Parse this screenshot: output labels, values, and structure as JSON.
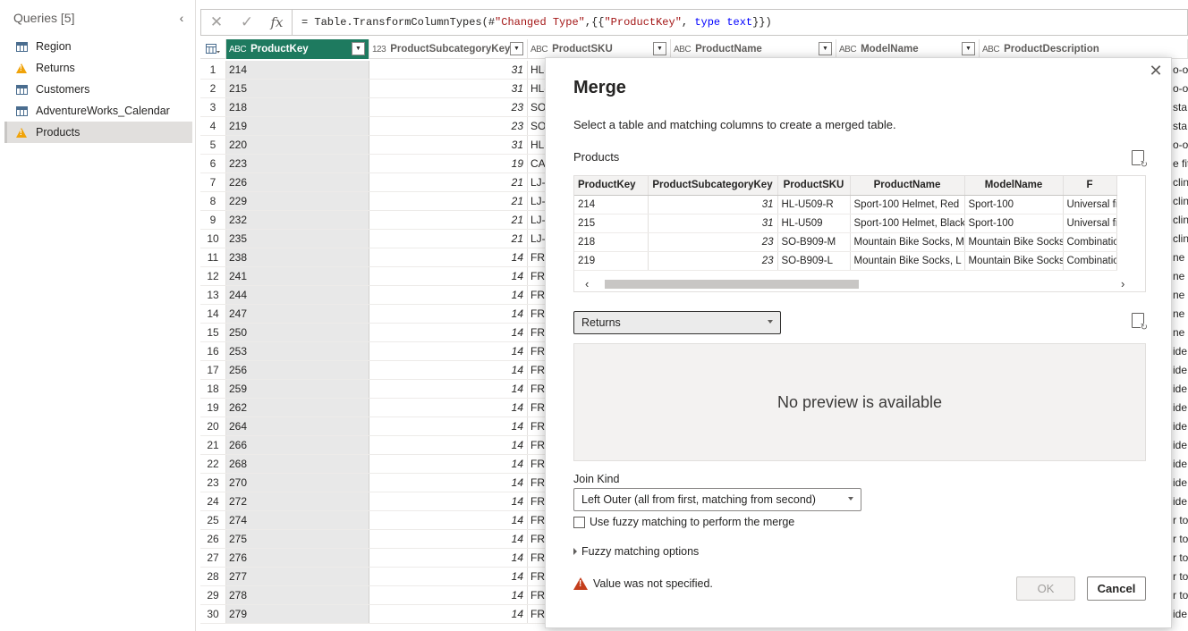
{
  "queries": {
    "header": "Queries [5]",
    "items": [
      {
        "label": "Region",
        "icon": "table-icon",
        "warning": false
      },
      {
        "label": "Returns",
        "icon": "warning-icon",
        "warning": true
      },
      {
        "label": "Customers",
        "icon": "table-icon",
        "warning": false
      },
      {
        "label": "AdventureWorks_Calendar",
        "icon": "table-icon",
        "warning": false
      },
      {
        "label": "Products",
        "icon": "warning-icon",
        "warning": true,
        "selected": true
      }
    ]
  },
  "formula": {
    "prefix": "= Table.TransformColumnTypes(#",
    "str1": "\"Changed Type\"",
    "mid": ",{{",
    "str2": "\"ProductKey\"",
    "mid2": ", ",
    "kw": "type text",
    "suffix": "}})"
  },
  "grid": {
    "columns": [
      {
        "type": "ABC",
        "name": "ProductKey"
      },
      {
        "type": "123",
        "name": "ProductSubcategoryKey"
      },
      {
        "type": "ABC",
        "name": "ProductSKU"
      },
      {
        "type": "ABC",
        "name": "ProductName"
      },
      {
        "type": "ABC",
        "name": "ModelName"
      },
      {
        "type": "ABC",
        "name": "ProductDescription"
      }
    ],
    "rows": [
      {
        "n": "1",
        "key": "214",
        "sub": "31",
        "sku": "HL-",
        "right": "o-or"
      },
      {
        "n": "2",
        "key": "215",
        "sub": "31",
        "sku": "HL-",
        "right": "o-or"
      },
      {
        "n": "3",
        "key": "218",
        "sub": "23",
        "sku": "SO",
        "right": "sta"
      },
      {
        "n": "4",
        "key": "219",
        "sub": "23",
        "sku": "SO",
        "right": "sta"
      },
      {
        "n": "5",
        "key": "220",
        "sub": "31",
        "sku": "HL-",
        "right": "o-or"
      },
      {
        "n": "6",
        "key": "223",
        "sub": "19",
        "sku": "CA",
        "right": "e fit"
      },
      {
        "n": "7",
        "key": "226",
        "sub": "21",
        "sku": "LJ-",
        "right": "clin"
      },
      {
        "n": "8",
        "key": "229",
        "sub": "21",
        "sku": "LJ-",
        "right": "clin"
      },
      {
        "n": "9",
        "key": "232",
        "sub": "21",
        "sku": "LJ-",
        "right": "clin"
      },
      {
        "n": "10",
        "key": "235",
        "sub": "21",
        "sku": "LJ-",
        "right": "clin"
      },
      {
        "n": "11",
        "key": "238",
        "sub": "14",
        "sku": "FR-",
        "right": "ne r"
      },
      {
        "n": "12",
        "key": "241",
        "sub": "14",
        "sku": "FR-",
        "right": "ne r"
      },
      {
        "n": "13",
        "key": "244",
        "sub": "14",
        "sku": "FR-",
        "right": "ne r"
      },
      {
        "n": "14",
        "key": "247",
        "sub": "14",
        "sku": "FR-",
        "right": "ne r"
      },
      {
        "n": "15",
        "key": "250",
        "sub": "14",
        "sku": "FR-",
        "right": "ne r"
      },
      {
        "n": "16",
        "key": "253",
        "sub": "14",
        "sku": "FR-",
        "right": "ide,"
      },
      {
        "n": "17",
        "key": "256",
        "sub": "14",
        "sku": "FR-",
        "right": "ide,"
      },
      {
        "n": "18",
        "key": "259",
        "sub": "14",
        "sku": "FR-",
        "right": "ide,"
      },
      {
        "n": "19",
        "key": "262",
        "sub": "14",
        "sku": "FR-",
        "right": "ide,"
      },
      {
        "n": "20",
        "key": "264",
        "sub": "14",
        "sku": "FR-",
        "right": "ide,"
      },
      {
        "n": "21",
        "key": "266",
        "sub": "14",
        "sku": "FR-",
        "right": "ide,"
      },
      {
        "n": "22",
        "key": "268",
        "sub": "14",
        "sku": "FR-",
        "right": "ide,"
      },
      {
        "n": "23",
        "key": "270",
        "sub": "14",
        "sku": "FR-",
        "right": "ide,"
      },
      {
        "n": "24",
        "key": "272",
        "sub": "14",
        "sku": "FR-",
        "right": "ide,"
      },
      {
        "n": "25",
        "key": "274",
        "sub": "14",
        "sku": "FR-",
        "right": "r top"
      },
      {
        "n": "26",
        "key": "275",
        "sub": "14",
        "sku": "FR-",
        "right": "r top"
      },
      {
        "n": "27",
        "key": "276",
        "sub": "14",
        "sku": "FR-",
        "right": "r top"
      },
      {
        "n": "28",
        "key": "277",
        "sub": "14",
        "sku": "FR-",
        "right": "r top"
      },
      {
        "n": "29",
        "key": "278",
        "sub": "14",
        "sku": "FR-",
        "right": "r top"
      },
      {
        "n": "30",
        "key": "279",
        "sub": "14",
        "sku": "FR-",
        "right": "ide,"
      }
    ]
  },
  "modal": {
    "title": "Merge",
    "description": "Select a table and matching columns to create a merged table.",
    "first_table": "Products",
    "preview_headers": [
      "ProductKey",
      "ProductSubcategoryKey",
      "ProductSKU",
      "ProductName",
      "ModelName",
      "F"
    ],
    "preview_rows": [
      [
        "214",
        "31",
        "HL-U509-R",
        "Sport-100 Helmet, Red",
        "Sport-100",
        "Universal fit, well-"
      ],
      [
        "215",
        "31",
        "HL-U509",
        "Sport-100 Helmet, Black",
        "Sport-100",
        "Universal fit, well-"
      ],
      [
        "218",
        "23",
        "SO-B909-M",
        "Mountain Bike Socks, M",
        "Mountain Bike Socks",
        "Combination of na"
      ],
      [
        "219",
        "23",
        "SO-B909-L",
        "Mountain Bike Socks, L",
        "Mountain Bike Socks",
        "Combination of na"
      ]
    ],
    "second_table": "Returns",
    "no_preview": "No preview is available",
    "join_kind_label": "Join Kind",
    "join_kind_value": "Left Outer (all from first, matching from second)",
    "fuzzy_label": "Use fuzzy matching to perform the merge",
    "fuzzy_options": "Fuzzy matching options",
    "validation": "Value was not specified.",
    "ok": "OK",
    "cancel": "Cancel"
  }
}
